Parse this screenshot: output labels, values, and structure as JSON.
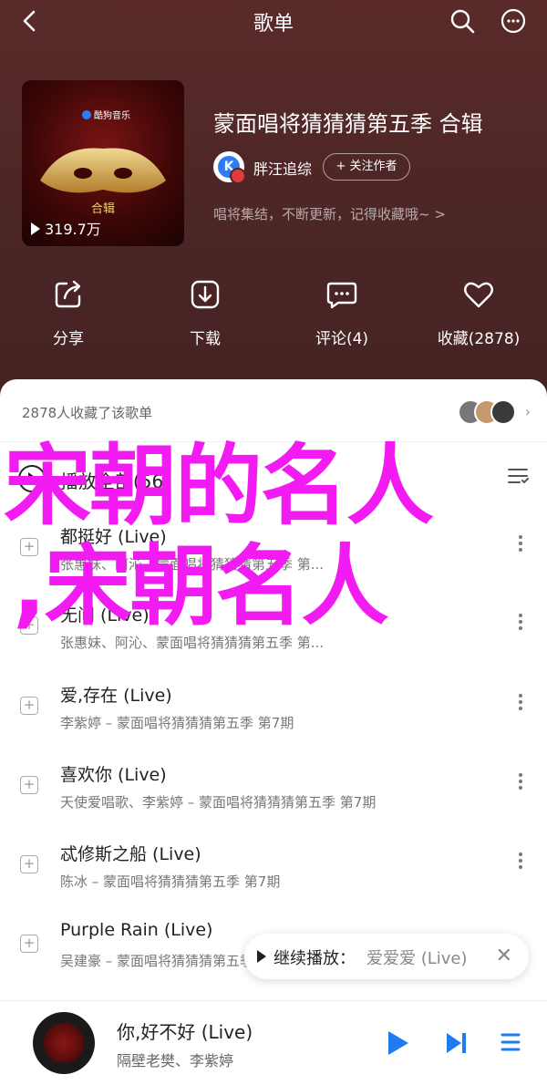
{
  "header": {
    "title": "歌单"
  },
  "cover": {
    "brand": "酷狗音乐",
    "sub": "合辑",
    "plays": "319.7万"
  },
  "playlist": {
    "title": "蒙面唱将猜猜猜第五季 合辑",
    "creator": "胖汪追综",
    "follow_label": "+ 关注作者",
    "description": "唱将集结，不断更新，记得收藏哦~ >"
  },
  "actions": [
    {
      "label": "分享",
      "icon": "share-icon"
    },
    {
      "label": "下载",
      "icon": "download-icon"
    },
    {
      "label": "评论(4)",
      "icon": "comment-icon"
    },
    {
      "label": "收藏(2878)",
      "icon": "heart-icon"
    }
  ],
  "favorites": {
    "text": "2878人收藏了该歌单"
  },
  "play_all": {
    "label": "播放全部(56)"
  },
  "songs": [
    {
      "title": "都挺好 (Live)",
      "subtitle": "张惠妹、阿沁、蒙面唱将猜猜猜第五季 第..."
    },
    {
      "title": "无问 (Live)",
      "subtitle": "张惠妹、阿沁、蒙面唱将猜猜猜第五季 第..."
    },
    {
      "title": "爱,存在 (Live)",
      "subtitle": "李紫婷 – 蒙面唱将猜猜猜第五季 第7期"
    },
    {
      "title": "喜欢你 (Live)",
      "subtitle": "天使爱唱歌、李紫婷 – 蒙面唱将猜猜猜第五季 第7期"
    },
    {
      "title": "忒修斯之船 (Live)",
      "subtitle": "陈冰 – 蒙面唱将猜猜猜第五季 第7期"
    },
    {
      "title": "Purple Rain (Live)",
      "subtitle": "吴建豪 – 蒙面唱将猜猜猜第五季"
    }
  ],
  "overlay": {
    "line1": "宋朝的名人",
    "line2": ",宋朝名人"
  },
  "continue": {
    "label": "继续播放：",
    "song": "爱爱爱 (Live)"
  },
  "player": {
    "title": "你,好不好 (Live)",
    "artists": "隔壁老樊、李紫婷"
  }
}
